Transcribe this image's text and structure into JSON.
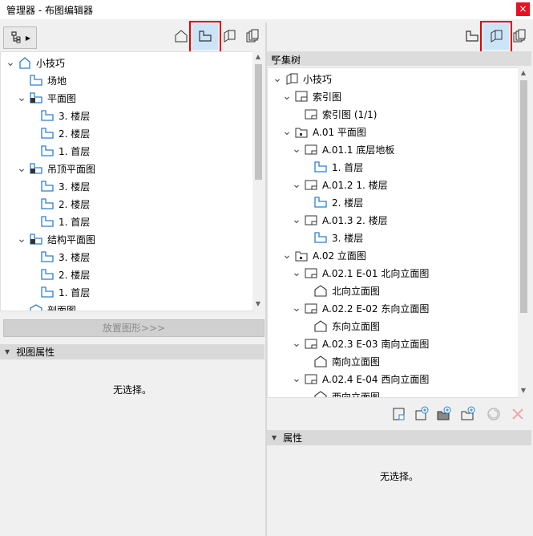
{
  "window": {
    "title": "管理器 - 布图编辑器",
    "close_glyph": "×"
  },
  "left": {
    "tree": [
      {
        "label": "小技巧",
        "depth": 0,
        "arrow": "down",
        "icon": "project-icon"
      },
      {
        "label": "场地",
        "depth": 1,
        "arrow": "none",
        "icon": "story-icon"
      },
      {
        "label": "平面图",
        "depth": 1,
        "arrow": "down",
        "icon": "folder-plan-icon"
      },
      {
        "label": "3. 楼层",
        "depth": 2,
        "arrow": "none",
        "icon": "story-icon"
      },
      {
        "label": "2. 楼层",
        "depth": 2,
        "arrow": "none",
        "icon": "story-icon"
      },
      {
        "label": "1. 首层",
        "depth": 2,
        "arrow": "none",
        "icon": "story-icon"
      },
      {
        "label": "吊顶平面图",
        "depth": 1,
        "arrow": "down",
        "icon": "folder-plan-icon"
      },
      {
        "label": "3. 楼层",
        "depth": 2,
        "arrow": "none",
        "icon": "story-icon"
      },
      {
        "label": "2. 楼层",
        "depth": 2,
        "arrow": "none",
        "icon": "story-icon"
      },
      {
        "label": "1. 首层",
        "depth": 2,
        "arrow": "none",
        "icon": "story-icon"
      },
      {
        "label": "结构平面图",
        "depth": 1,
        "arrow": "down",
        "icon": "folder-plan-icon"
      },
      {
        "label": "3. 楼层",
        "depth": 2,
        "arrow": "none",
        "icon": "story-icon"
      },
      {
        "label": "2. 楼层",
        "depth": 2,
        "arrow": "none",
        "icon": "story-icon"
      },
      {
        "label": "1. 首层",
        "depth": 2,
        "arrow": "none",
        "icon": "story-icon"
      },
      {
        "label": "剖面图",
        "depth": 1,
        "arrow": "none",
        "icon": "section-icon"
      }
    ],
    "place_button": "放置图形>>>",
    "view_props_title": "视图属性",
    "no_selection": "无选择。"
  },
  "right": {
    "subset_tree_title": "子集树",
    "tree": [
      {
        "label": "小技巧",
        "depth": 0,
        "arrow": "down",
        "icon": "book-icon"
      },
      {
        "label": "索引图",
        "depth": 1,
        "arrow": "down",
        "icon": "layout-icon"
      },
      {
        "label": "索引图 (1/1)",
        "depth": 2,
        "arrow": "none",
        "icon": "sheet-icon"
      },
      {
        "label": "A.01 平面图",
        "depth": 1,
        "arrow": "down",
        "icon": "subset-folder-icon"
      },
      {
        "label": "A.01.1 底层地板",
        "depth": 2,
        "arrow": "down",
        "icon": "sheet-icon"
      },
      {
        "label": "1. 首层",
        "depth": 3,
        "arrow": "none",
        "icon": "story-icon"
      },
      {
        "label": "A.01.2 1. 楼层",
        "depth": 2,
        "arrow": "down",
        "icon": "sheet-icon"
      },
      {
        "label": "2. 楼层",
        "depth": 3,
        "arrow": "none",
        "icon": "story-icon"
      },
      {
        "label": "A.01.3 2. 楼层",
        "depth": 2,
        "arrow": "down",
        "icon": "sheet-icon"
      },
      {
        "label": "3. 楼层",
        "depth": 3,
        "arrow": "none",
        "icon": "story-icon"
      },
      {
        "label": "A.02 立面图",
        "depth": 1,
        "arrow": "down",
        "icon": "subset-folder-icon"
      },
      {
        "label": "A.02.1 E-01 北向立面图",
        "depth": 2,
        "arrow": "down",
        "icon": "sheet-icon"
      },
      {
        "label": "北向立面图",
        "depth": 3,
        "arrow": "none",
        "icon": "elevation-icon"
      },
      {
        "label": "A.02.2 E-02 东向立面图",
        "depth": 2,
        "arrow": "down",
        "icon": "sheet-icon"
      },
      {
        "label": "东向立面图",
        "depth": 3,
        "arrow": "none",
        "icon": "elevation-icon"
      },
      {
        "label": "A.02.3 E-03 南向立面图",
        "depth": 2,
        "arrow": "down",
        "icon": "sheet-icon"
      },
      {
        "label": "南向立面图",
        "depth": 3,
        "arrow": "none",
        "icon": "elevation-icon"
      },
      {
        "label": "A.02.4 E-04 西向立面图",
        "depth": 2,
        "arrow": "down",
        "icon": "sheet-icon"
      },
      {
        "label": "西向立面图",
        "depth": 3,
        "arrow": "none",
        "icon": "elevation-icon"
      }
    ],
    "props_title": "属性",
    "no_selection": "无选择。"
  },
  "colors": {
    "highlight": "#e60000",
    "selected_bg": "#cce4f7",
    "icon_blue": "#2a7fd4"
  }
}
